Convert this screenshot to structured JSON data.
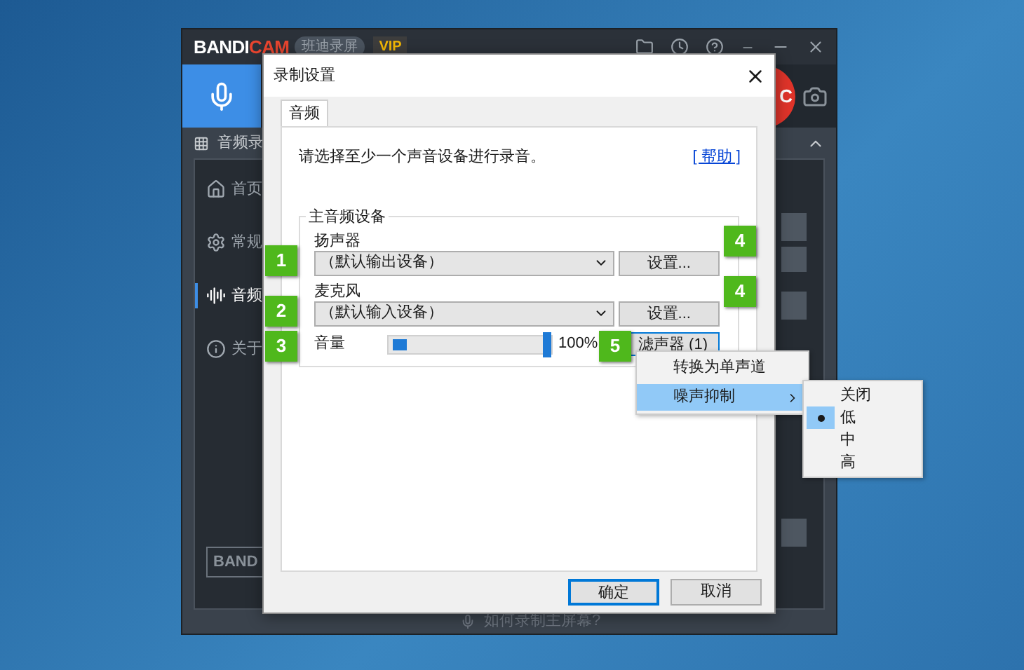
{
  "app": {
    "logo_left": "BANDI",
    "logo_right": "CAM",
    "edition": "班迪录屏",
    "badge": "VIP",
    "rec_label": "C",
    "section": "音频录",
    "sidebar": [
      {
        "label": "首页",
        "kind": "home",
        "selected": false
      },
      {
        "label": "常规",
        "kind": "general",
        "selected": false
      },
      {
        "label": "音频",
        "kind": "audio",
        "selected": true
      },
      {
        "label": "关于",
        "kind": "about",
        "selected": false
      }
    ],
    "bottom_button": "BAND",
    "hint": "如何录制主屏幕?"
  },
  "dialog": {
    "title": "录制设置",
    "tabs": [
      {
        "label": "音频",
        "selected": true
      }
    ],
    "instruction": "请选择至少一个声音设备进行录音。",
    "help_link": "[ 帮助 ]",
    "group_title": "主音频设备",
    "devices": [
      {
        "badge": "1",
        "label": "扬声器",
        "value": "（默认输出设备）",
        "button": "设置...",
        "button_badge": "4"
      },
      {
        "badge": "2",
        "label": "麦克风",
        "value": "（默认输入设备）",
        "button": "设置...",
        "button_badge": "4"
      }
    ],
    "volume": {
      "badge": "3",
      "label": "音量",
      "level": 1.0,
      "reading": "100%"
    },
    "filter": {
      "badge": "5",
      "label": "滤声器 (1)",
      "focused": true
    },
    "buttons": [
      {
        "label": "确定",
        "default": true
      },
      {
        "label": "取消",
        "default": false
      }
    ]
  },
  "menu": {
    "items": [
      {
        "label": "转换为单声道",
        "kind": "item",
        "selected": false
      },
      {
        "label": "噪声抑制",
        "kind": "submenu",
        "selected": true
      }
    ],
    "submenu": [
      {
        "label": "关闭",
        "selected": false
      },
      {
        "label": "低",
        "selected": true
      },
      {
        "label": "中",
        "selected": false
      },
      {
        "label": "高",
        "selected": false
      }
    ]
  }
}
